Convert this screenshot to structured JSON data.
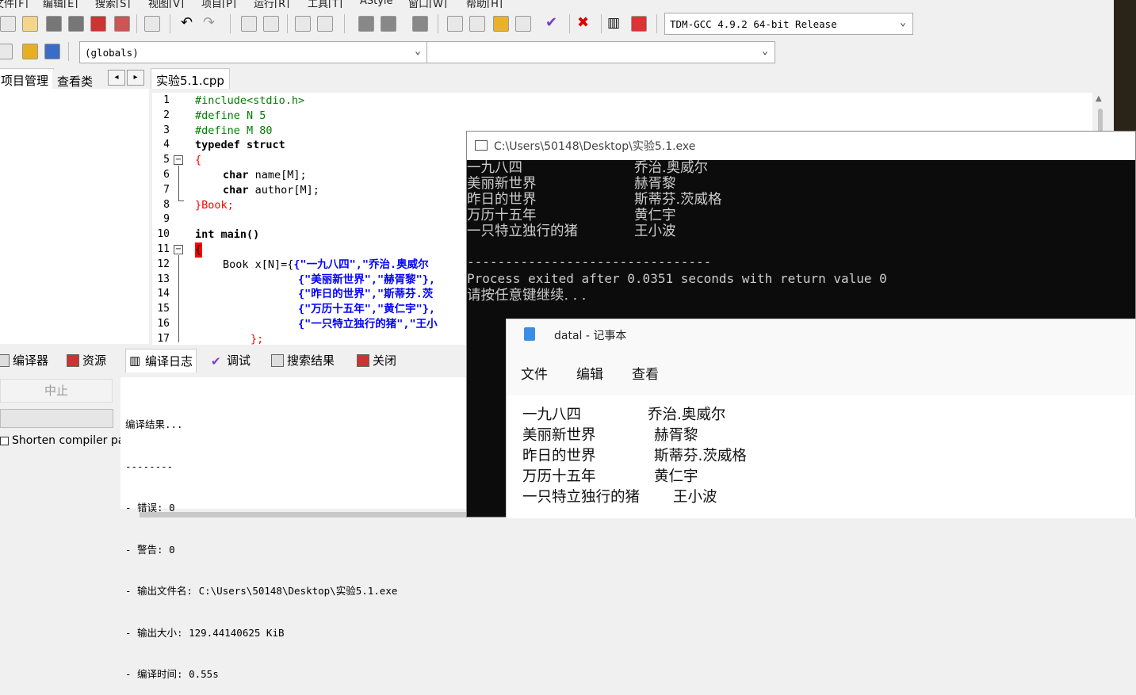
{
  "menu": [
    "文件[F]",
    "编辑[E]",
    "搜索[S]",
    "视图[V]",
    "项目[P]",
    "运行[R]",
    "工具[T]",
    "AStyle",
    "窗口[W]",
    "帮助[H]"
  ],
  "compiler_select": "TDM-GCC 4.9.2 64-bit Release",
  "globals_select": "(globals)",
  "second_select": "",
  "left_tabs": {
    "project": "项目管理",
    "classes": "查看类"
  },
  "file_tab": "实验5.1.cpp",
  "line_numbers": [
    "1",
    "2",
    "3",
    "4",
    "5",
    "6",
    "7",
    "8",
    "9",
    "10",
    "11",
    "12",
    "13",
    "14",
    "15",
    "16",
    "17"
  ],
  "code": {
    "l1": "#include<stdio.h>",
    "l2": "#define N 5",
    "l3": "#define M 80",
    "l4_kw": "typedef struct",
    "l5": "{",
    "l6_kw": "char",
    "l6_rest": " name[M];",
    "l7_kw": "char",
    "l7_rest": " author[M];",
    "l8": "}Book;",
    "l10": "int main()",
    "l11": "{",
    "l12_pre": "Book x[N]={",
    "l12_str": "{\"一九八四\",\"乔治.奥威尔",
    "l13": "{\"美丽新世界\",\"赫胥黎\"},",
    "l14": "{\"昨日的世界\",\"斯蒂芬.茨",
    "l15": "{\"万历十五年\",\"黄仁宇\"},",
    "l16": "{\"一只特立独行的猪\",\"王小",
    "l17": "};"
  },
  "bottom_tabs": {
    "compiler": "编译器",
    "resources": "资源",
    "compile_log": "编译日志",
    "debug": "调试",
    "search_results": "搜索结果",
    "close": "关闭"
  },
  "abort_button": "中止",
  "shorten_checkbox": "Shorten compiler pa",
  "log_lines": [
    "编译结果...",
    "--------",
    "- 错误: 0",
    "- 警告: 0",
    "- 输出文件名: C:\\Users\\50148\\Desktop\\实验5.1.exe",
    "- 输出大小: 129.44140625 KiB",
    "- 编译时间: 0.55s"
  ],
  "console": {
    "title": "C:\\Users\\50148\\Desktop\\实验5.1.exe",
    "rows": [
      {
        "book": "一九八四",
        "author": "乔治.奥威尔"
      },
      {
        "book": "美丽新世界",
        "author": "赫胥黎"
      },
      {
        "book": "昨日的世界",
        "author": "斯蒂芬.茨威格"
      },
      {
        "book": "万历十五年",
        "author": "黄仁宇"
      },
      {
        "book": "一只特立独行的猪",
        "author": "王小波"
      }
    ],
    "divider": "--------------------------------",
    "exit": "Process exited after 0.0351 seconds with return value 0",
    "prompt": "请按任意键继续. . ."
  },
  "notepad": {
    "title": "datal - 记事本",
    "menu": [
      "文件",
      "编辑",
      "查看"
    ],
    "rows": [
      {
        "book": "一九八四",
        "author": "乔治.奥威尔"
      },
      {
        "book": "美丽新世界",
        "author": "赫胥黎"
      },
      {
        "book": "昨日的世界",
        "author": "斯蒂芬.茨威格"
      },
      {
        "book": "万历十五年",
        "author": "黄仁宇"
      },
      {
        "book": "一只特立独行的猪",
        "author": "王小波"
      }
    ]
  }
}
